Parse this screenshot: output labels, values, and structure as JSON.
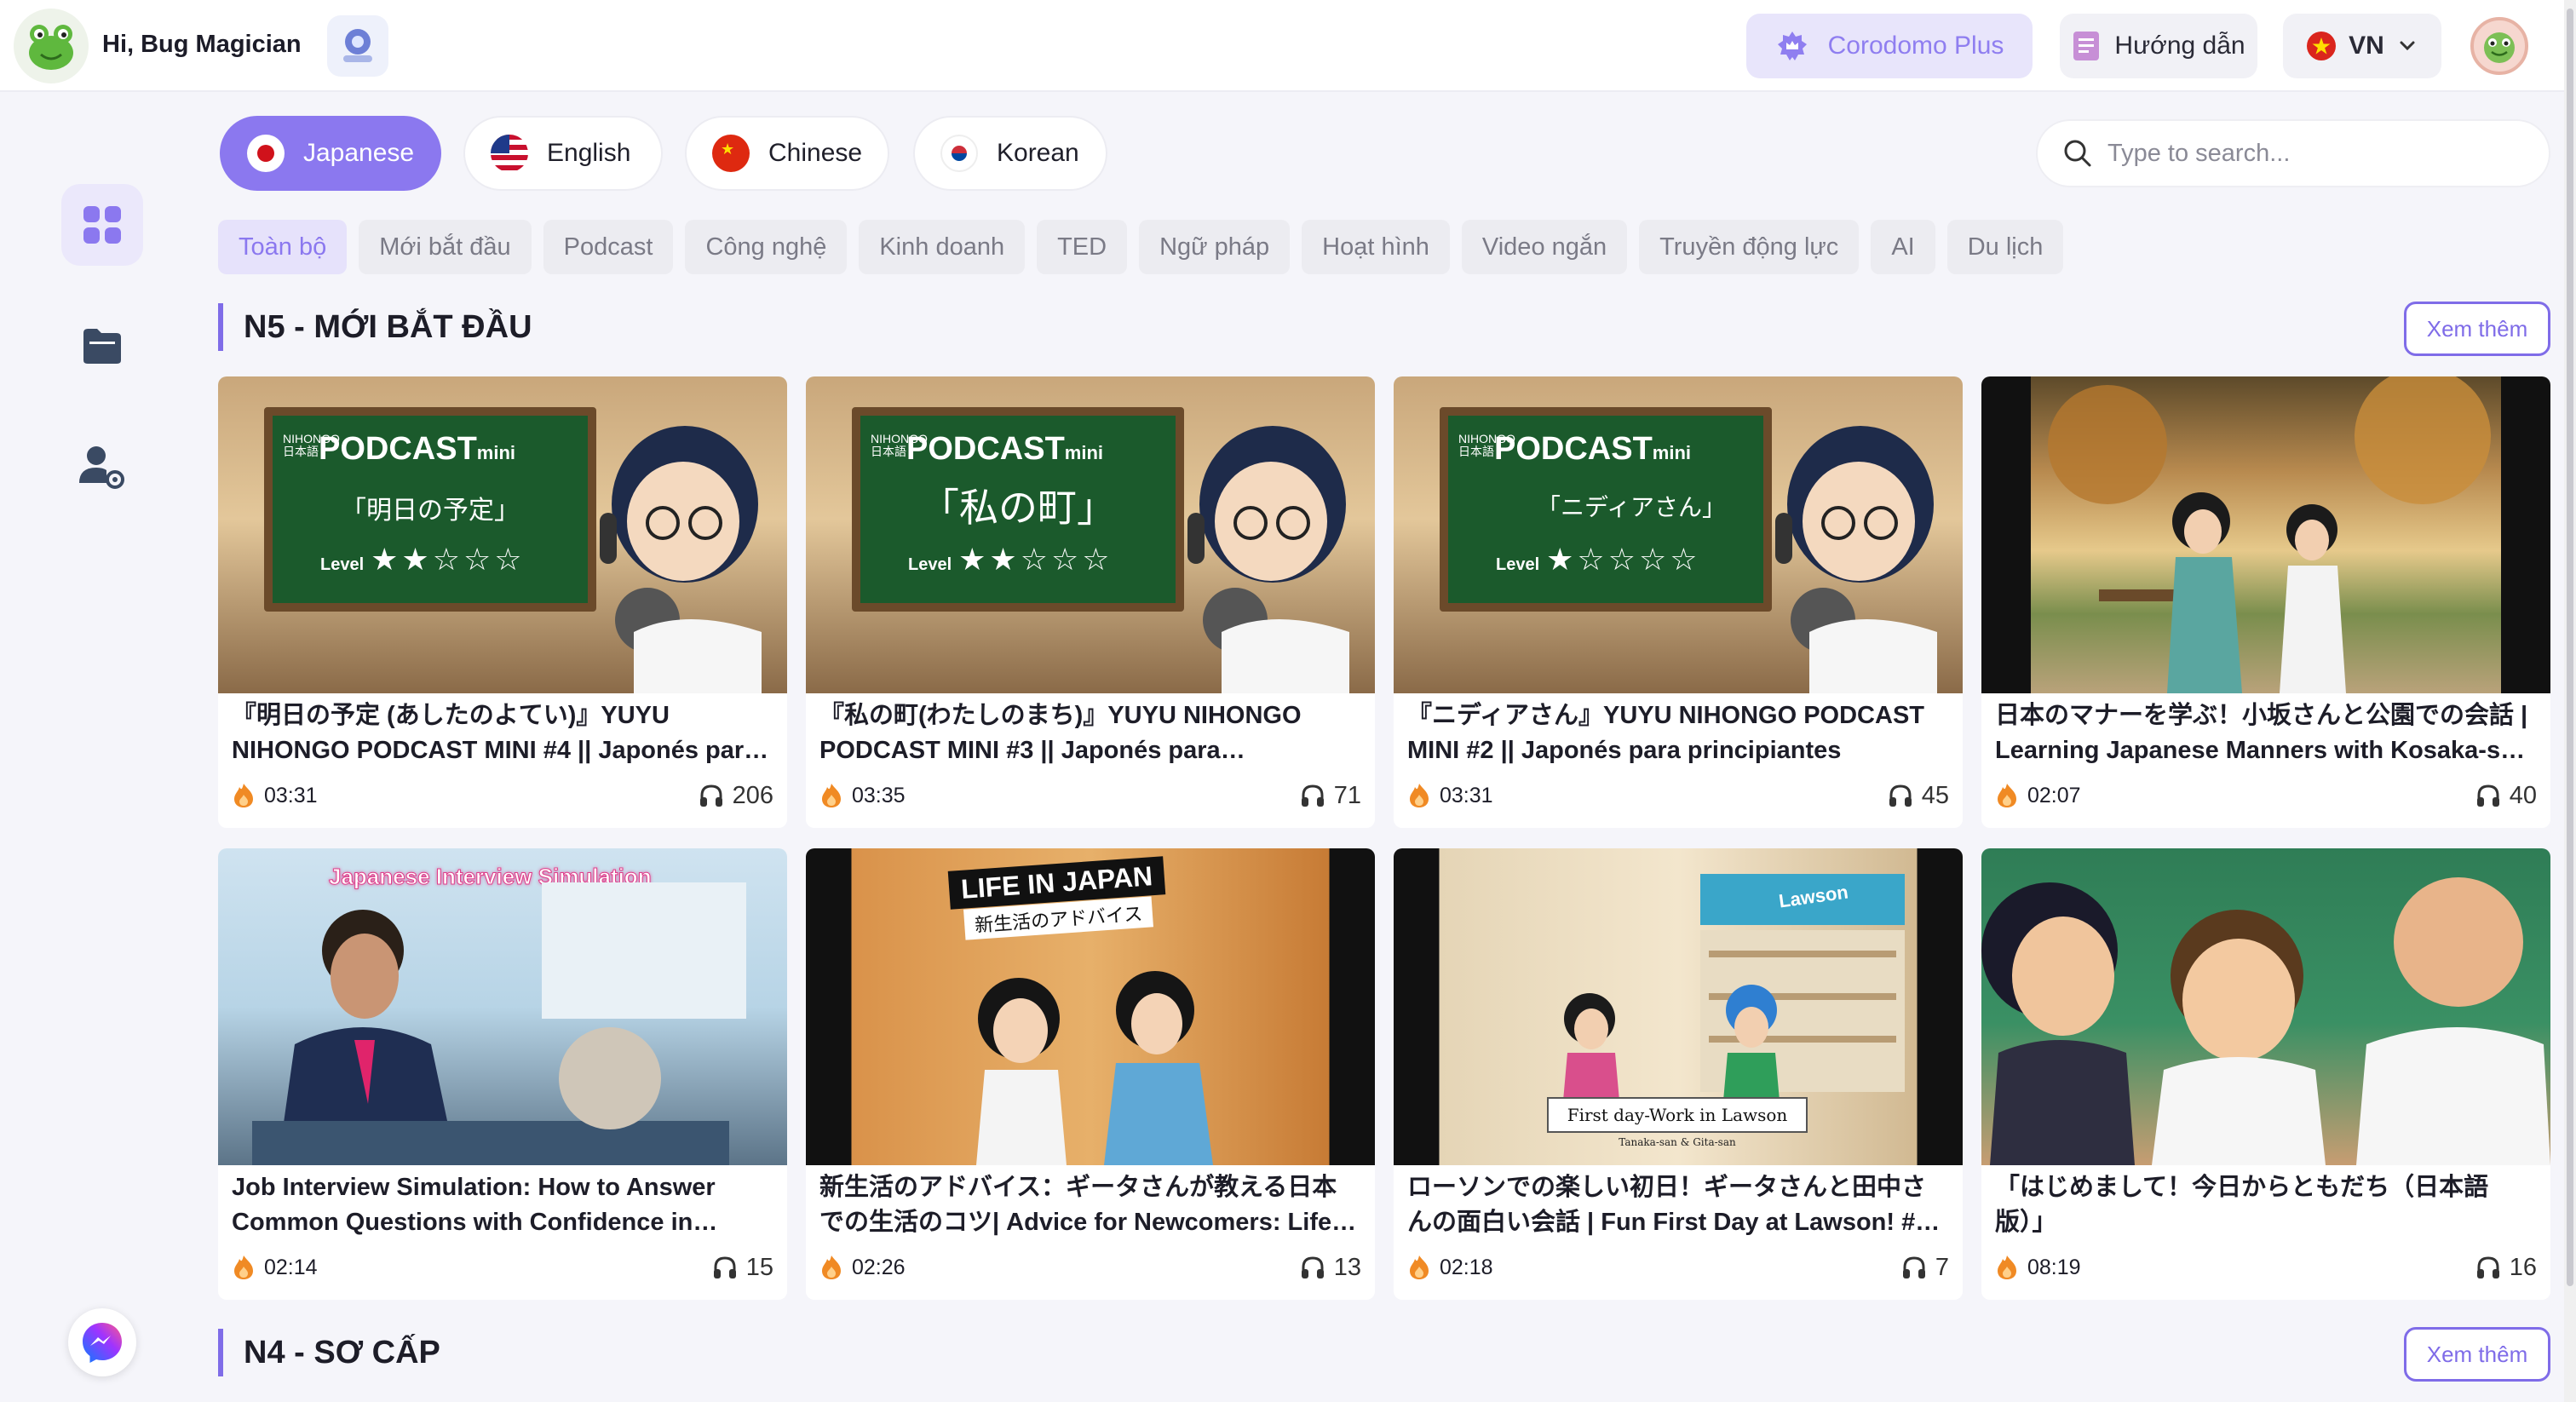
{
  "header": {
    "greeting": "Hi, Bug Magician",
    "plus_label": "Corodomo Plus",
    "guide_label": "Hướng dẫn",
    "language_code": "VN"
  },
  "languages": [
    {
      "label": "Japanese",
      "active": true
    },
    {
      "label": "English",
      "active": false
    },
    {
      "label": "Chinese",
      "active": false
    },
    {
      "label": "Korean",
      "active": false
    }
  ],
  "search": {
    "placeholder": "Type to search..."
  },
  "categories": [
    "Toàn bộ",
    "Mới bắt đầu",
    "Podcast",
    "Công nghệ",
    "Kinh doanh",
    "TED",
    "Ngữ pháp",
    "Hoạt hình",
    "Video ngắn",
    "Truyền động lực",
    "AI",
    "Du lịch"
  ],
  "sections": [
    {
      "title": "N5 - MỚI BẮT ĐẦU",
      "more_label": "Xem thêm",
      "videos": [
        {
          "title": "『明日の予定 (あしたのよてい)』YUYU NIHONGO PODCAST MINI #4 || Japonés para principiantes",
          "duration": "03:31",
          "listens": "206",
          "thumb_text": "「明日の予定」"
        },
        {
          "title": "『私の町(わたしのまち)』YUYU NIHONGO PODCAST MINI #3 || Japonés para principiantes",
          "duration": "03:35",
          "listens": "71",
          "thumb_text": "「私の町」"
        },
        {
          "title": "『ニディアさん』YUYU NIHONGO PODCAST MINI #2 || Japonés para principiantes",
          "duration": "03:31",
          "listens": "45",
          "thumb_text": "「ニディアさん」"
        },
        {
          "title": "日本のマナーを学ぶ！小坂さんと公園での会話 | Learning Japanese Manners with Kosaka-san in the Park",
          "duration": "02:07",
          "listens": "40"
        },
        {
          "title": "Job Interview Simulation: How to Answer Common Questions with Confidence in Japanese",
          "duration": "02:14",
          "listens": "15",
          "thumb_text": "Japanese Interview Simulation"
        },
        {
          "title": "新生活のアドバイス：ギータさんが教える日本での生活のコツ| Advice for Newcomers: Life in Japan",
          "duration": "02:26",
          "listens": "13",
          "thumb_text": "LIFE IN JAPAN",
          "thumb_subtext": "新生活のアドバイス"
        },
        {
          "title": "ローソンでの楽しい初日！ギータさんと田中さんの面白い会話 | Fun First Day at Lawson! #コンビニ",
          "duration": "02:18",
          "listens": "7",
          "thumb_text": "First day-Work in Lawson",
          "thumb_subtext": "Tanaka-san & Gita-san",
          "thumb_sign": "Lawson"
        },
        {
          "title": "「はじめまして！今日からともだち（日本語版）」",
          "duration": "08:19",
          "listens": "16"
        }
      ]
    },
    {
      "title": "N4 - SƠ CẤP",
      "more_label": "Xem thêm"
    }
  ],
  "thumb_common": {
    "podcast_brand": "PODCAST",
    "podcast_mini": "mini",
    "podcast_nihongo": "NIHONGO",
    "podcast_nihongo_jp": "日本語",
    "level_label": "Level"
  },
  "colors": {
    "accent": "#8b78ef",
    "accent_dark": "#7f6ce8",
    "background": "#f5f5fa",
    "duration_icon": "#f08a24"
  },
  "icons": {
    "sidebar": [
      "dashboard-grid-icon",
      "folder-icon",
      "user-settings-icon"
    ],
    "duration": "fire-icon",
    "listens": "headphones-icon",
    "search": "search-icon"
  }
}
